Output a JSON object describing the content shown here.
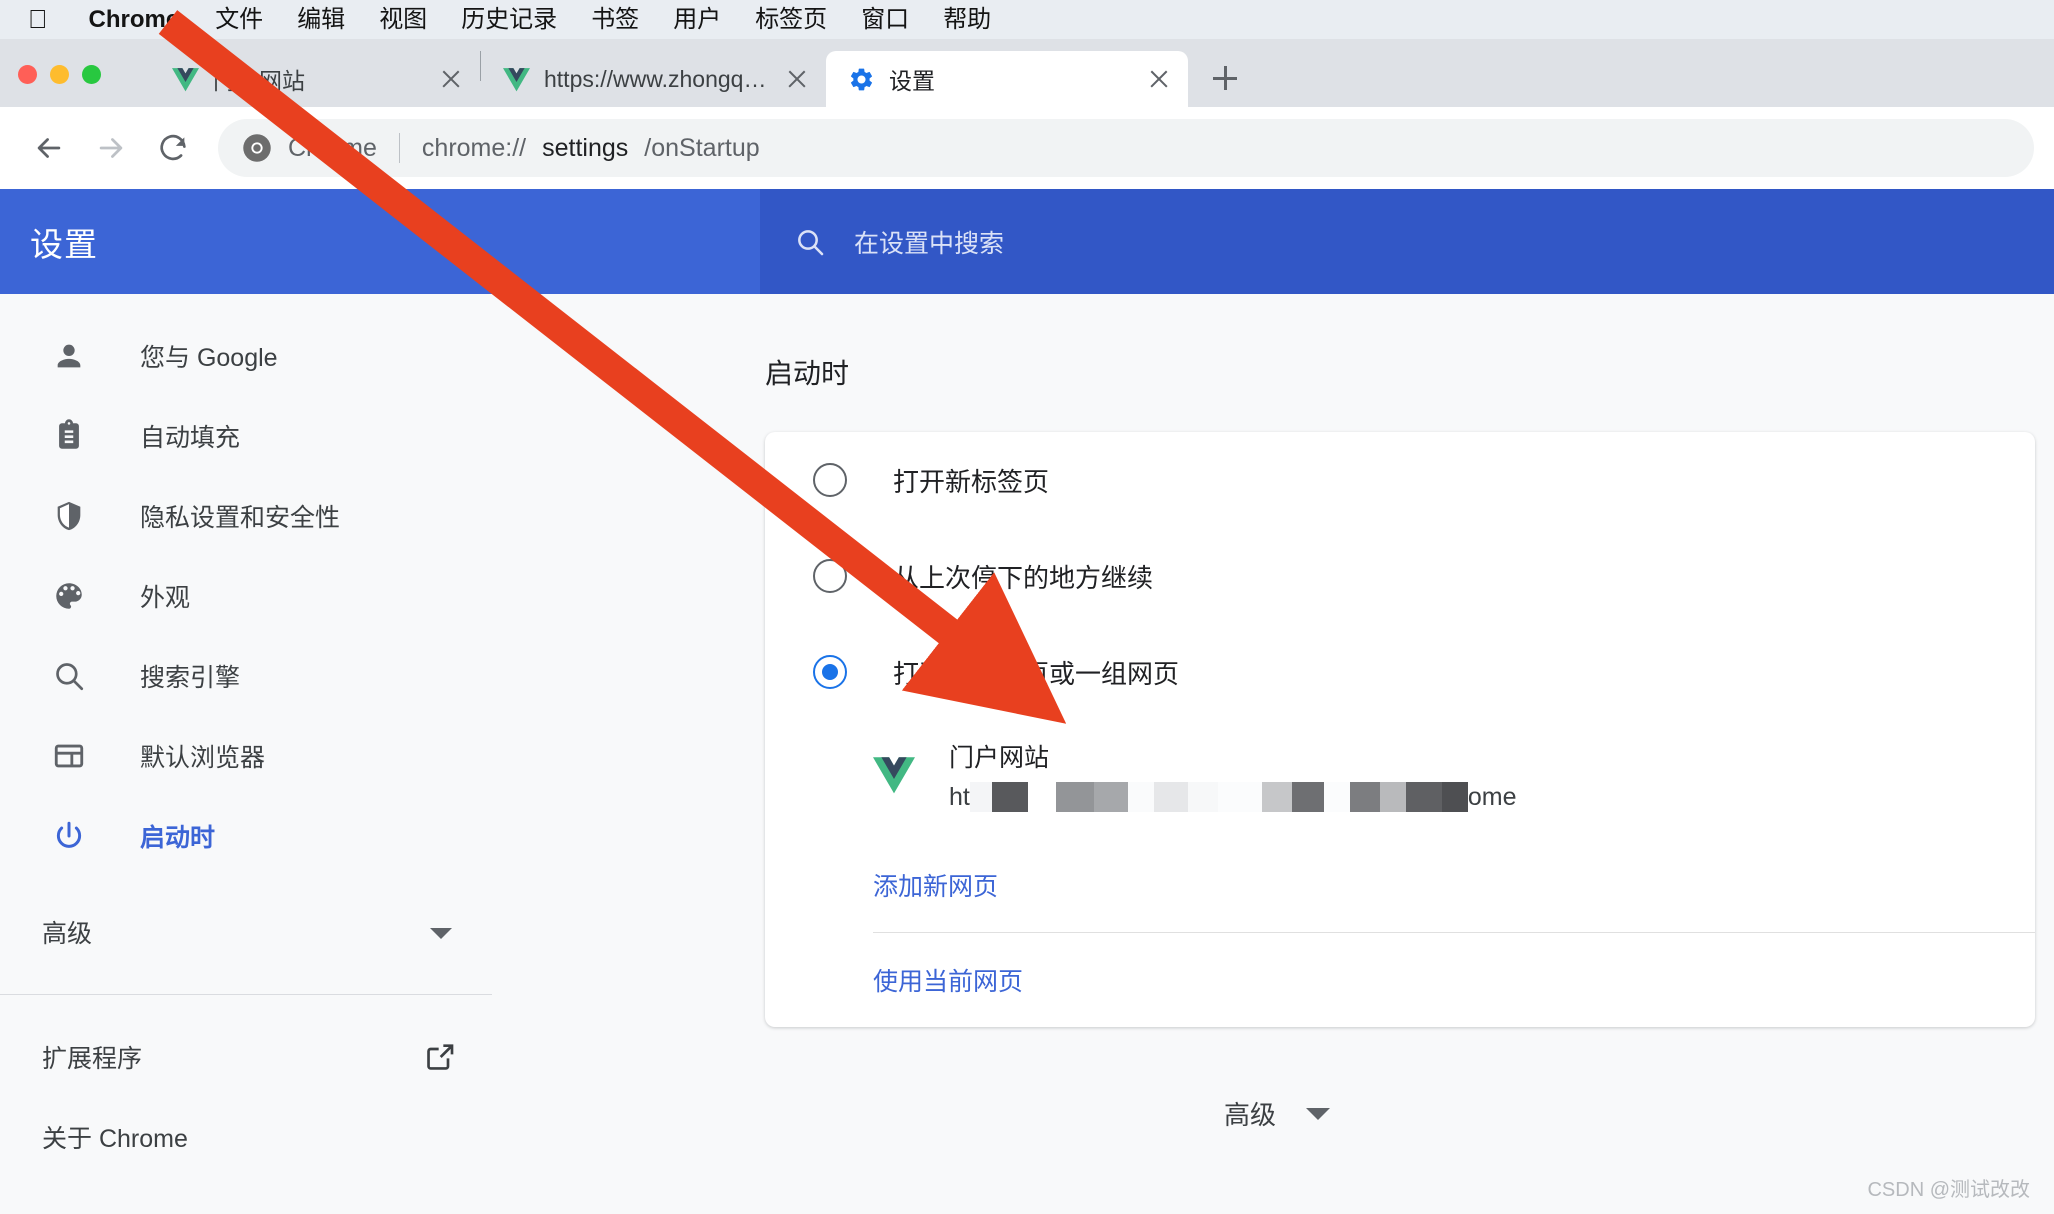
{
  "menubar": {
    "apple_logo": "",
    "items": [
      {
        "label": "Chrome",
        "bold": true
      },
      {
        "label": "文件"
      },
      {
        "label": "编辑"
      },
      {
        "label": "视图"
      },
      {
        "label": "历史记录"
      },
      {
        "label": "书签"
      },
      {
        "label": "用户"
      },
      {
        "label": "标签页"
      },
      {
        "label": "窗口"
      },
      {
        "label": "帮助"
      }
    ]
  },
  "tabs": [
    {
      "title": "门户网站",
      "favicon": "vue-icon",
      "active": false
    },
    {
      "title": "https://www.zhongqiyixin.com/",
      "favicon": "vue-icon",
      "active": false
    },
    {
      "title": "设置",
      "favicon": "gear-icon",
      "active": true
    }
  ],
  "toolbar": {
    "back": "back-arrow-icon",
    "forward": "forward-arrow-icon",
    "reload": "reload-icon",
    "omnibox": {
      "chip_label": "Chrome",
      "url_scheme": "chrome://",
      "url_path_strong": "settings",
      "url_path_rest": "/onStartup"
    },
    "newtab_label": "+"
  },
  "settings": {
    "header_title": "设置",
    "search_placeholder": "在设置中搜索",
    "sidebar": {
      "items": [
        {
          "label": "您与 Google",
          "icon": "person-icon",
          "active": false
        },
        {
          "label": "自动填充",
          "icon": "clipboard-icon",
          "active": false
        },
        {
          "label": "隐私设置和安全性",
          "icon": "shield-icon",
          "active": false
        },
        {
          "label": "外观",
          "icon": "palette-icon",
          "active": false
        },
        {
          "label": "搜索引擎",
          "icon": "search-icon",
          "active": false
        },
        {
          "label": "默认浏览器",
          "icon": "browser-window-icon",
          "active": false
        },
        {
          "label": "启动时",
          "icon": "power-icon",
          "active": true
        }
      ],
      "advanced_label": "高级",
      "extensions_label": "扩展程序",
      "about_label": "关于 Chrome"
    },
    "main": {
      "section_title": "启动时",
      "radio_options": [
        {
          "label": "打开新标签页",
          "selected": false
        },
        {
          "label": "从上次停下的地方继续",
          "selected": false
        },
        {
          "label": "打开特定网页或一组网页",
          "selected": true
        }
      ],
      "startup_site": {
        "name": "门户网站",
        "url_prefix": "ht",
        "url_suffix": "ome",
        "favicon": "vue-icon",
        "redacted": true
      },
      "add_page_link": "添加新网页",
      "use_current_link": "使用当前网页"
    },
    "footer": {
      "advanced_label": "高级",
      "watermark": "CSDN @测试改改"
    }
  },
  "annotation": {
    "arrow_color": "#e8401f",
    "type": "arrow-pointing-to-selected-radio"
  },
  "colors": {
    "header_blue": "#3c65d6",
    "search_blue": "#3257c6",
    "accent_blue": "#1a73e8",
    "link_blue": "#3c65d6",
    "sidebar_bg": "#f8f9fa",
    "tabstrip_bg": "#dee1e6"
  }
}
